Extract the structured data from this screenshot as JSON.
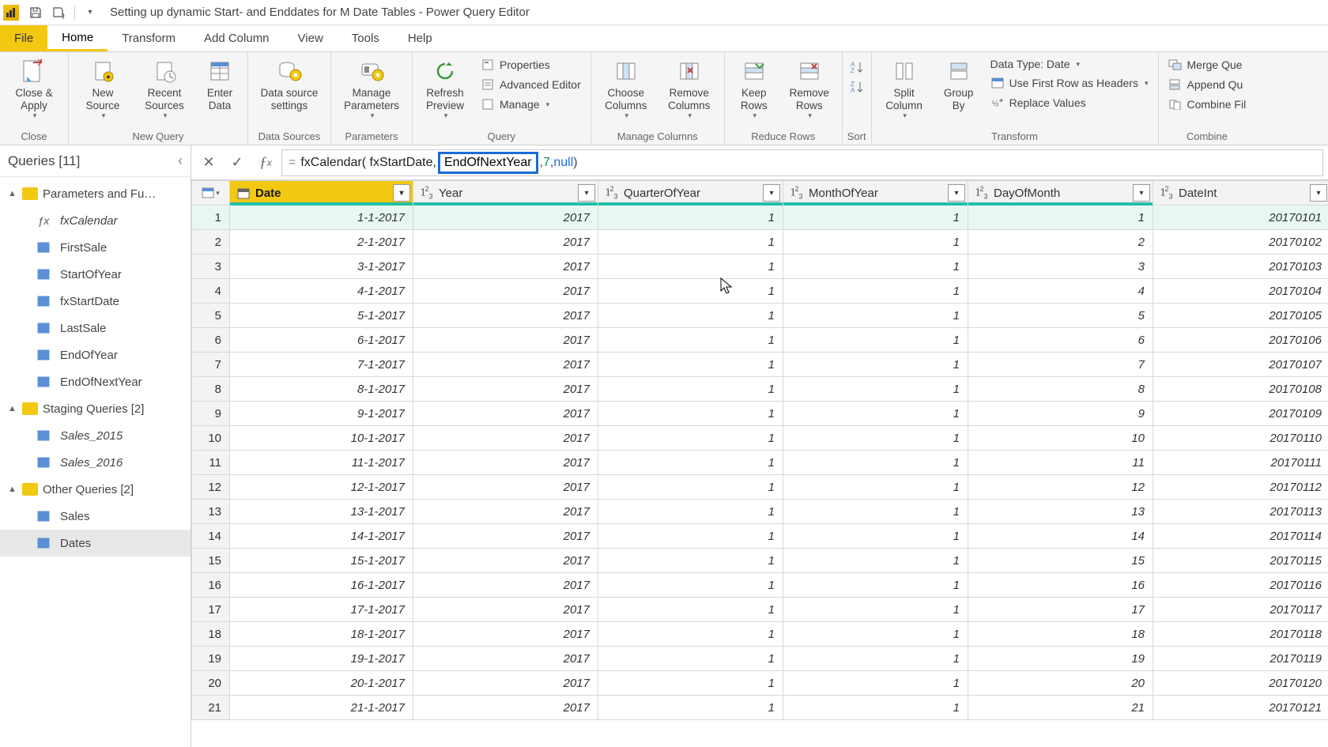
{
  "window": {
    "title": "Setting up dynamic Start- and Enddates for M Date Tables - Power Query Editor"
  },
  "tabs": {
    "file": "File",
    "home": "Home",
    "transform": "Transform",
    "add_column": "Add Column",
    "view": "View",
    "tools": "Tools",
    "help": "Help"
  },
  "ribbon": {
    "close_apply": "Close &\nApply",
    "close_group": "Close",
    "new_source": "New\nSource",
    "recent_sources": "Recent\nSources",
    "enter_data": "Enter\nData",
    "new_query_group": "New Query",
    "data_source_settings": "Data source\nsettings",
    "data_sources_group": "Data Sources",
    "manage_parameters": "Manage\nParameters",
    "parameters_group": "Parameters",
    "refresh_preview": "Refresh\nPreview",
    "properties": "Properties",
    "advanced_editor": "Advanced Editor",
    "manage": "Manage",
    "query_group": "Query",
    "choose_columns": "Choose\nColumns",
    "remove_columns": "Remove\nColumns",
    "manage_columns_group": "Manage Columns",
    "keep_rows": "Keep\nRows",
    "remove_rows": "Remove\nRows",
    "reduce_rows_group": "Reduce Rows",
    "sort_group": "Sort",
    "split_column": "Split\nColumn",
    "group_by": "Group\nBy",
    "data_type": "Data Type: Date",
    "use_first_row": "Use First Row as Headers",
    "replace_values": "Replace Values",
    "transform_group": "Transform",
    "merge_queries": "Merge Que",
    "append_queries": "Append Qu",
    "combine_files": "Combine Fil",
    "combine_group": "Combine"
  },
  "queries_pane": {
    "header": "Queries [11]",
    "groups": [
      {
        "label": "Parameters and Fu…",
        "items": [
          {
            "type": "fx",
            "label": "fxCalendar",
            "italic": true
          },
          {
            "type": "tbl",
            "label": "FirstSale"
          },
          {
            "type": "tbl",
            "label": "StartOfYear"
          },
          {
            "type": "tbl",
            "label": "fxStartDate"
          },
          {
            "type": "tbl",
            "label": "LastSale"
          },
          {
            "type": "tbl",
            "label": "EndOfYear"
          },
          {
            "type": "tbl",
            "label": "EndOfNextYear"
          }
        ]
      },
      {
        "label": "Staging Queries [2]",
        "items": [
          {
            "type": "tbl",
            "label": "Sales_2015",
            "italic": true
          },
          {
            "type": "tbl",
            "label": "Sales_2016",
            "italic": true
          }
        ]
      },
      {
        "label": "Other Queries [2]",
        "items": [
          {
            "type": "tbl",
            "label": "Sales"
          },
          {
            "type": "tbl",
            "label": "Dates",
            "selected": true
          }
        ]
      }
    ]
  },
  "formula": {
    "prefix": "fxCalendar( fxStartDate,",
    "highlight": "EndOfNextYear",
    "mid": ", ",
    "num": "7",
    "mid2": ", ",
    "null": "null",
    "suffix": ")"
  },
  "grid": {
    "columns": [
      {
        "name": "Date",
        "type": "date",
        "selected": true
      },
      {
        "name": "Year",
        "type": "num"
      },
      {
        "name": "QuarterOfYear",
        "type": "num"
      },
      {
        "name": "MonthOfYear",
        "type": "num"
      },
      {
        "name": "DayOfMonth",
        "type": "num"
      },
      {
        "name": "DateInt",
        "type": "num"
      }
    ],
    "rows": [
      [
        "1-1-2017",
        "2017",
        "1",
        "1",
        "1",
        "20170101"
      ],
      [
        "2-1-2017",
        "2017",
        "1",
        "1",
        "2",
        "20170102"
      ],
      [
        "3-1-2017",
        "2017",
        "1",
        "1",
        "3",
        "20170103"
      ],
      [
        "4-1-2017",
        "2017",
        "1",
        "1",
        "4",
        "20170104"
      ],
      [
        "5-1-2017",
        "2017",
        "1",
        "1",
        "5",
        "20170105"
      ],
      [
        "6-1-2017",
        "2017",
        "1",
        "1",
        "6",
        "20170106"
      ],
      [
        "7-1-2017",
        "2017",
        "1",
        "1",
        "7",
        "20170107"
      ],
      [
        "8-1-2017",
        "2017",
        "1",
        "1",
        "8",
        "20170108"
      ],
      [
        "9-1-2017",
        "2017",
        "1",
        "1",
        "9",
        "20170109"
      ],
      [
        "10-1-2017",
        "2017",
        "1",
        "1",
        "10",
        "20170110"
      ],
      [
        "11-1-2017",
        "2017",
        "1",
        "1",
        "11",
        "20170111"
      ],
      [
        "12-1-2017",
        "2017",
        "1",
        "1",
        "12",
        "20170112"
      ],
      [
        "13-1-2017",
        "2017",
        "1",
        "1",
        "13",
        "20170113"
      ],
      [
        "14-1-2017",
        "2017",
        "1",
        "1",
        "14",
        "20170114"
      ],
      [
        "15-1-2017",
        "2017",
        "1",
        "1",
        "15",
        "20170115"
      ],
      [
        "16-1-2017",
        "2017",
        "1",
        "1",
        "16",
        "20170116"
      ],
      [
        "17-1-2017",
        "2017",
        "1",
        "1",
        "17",
        "20170117"
      ],
      [
        "18-1-2017",
        "2017",
        "1",
        "1",
        "18",
        "20170118"
      ],
      [
        "19-1-2017",
        "2017",
        "1",
        "1",
        "19",
        "20170119"
      ],
      [
        "20-1-2017",
        "2017",
        "1",
        "1",
        "20",
        "20170120"
      ],
      [
        "21-1-2017",
        "2017",
        "1",
        "1",
        "21",
        "20170121"
      ]
    ]
  }
}
